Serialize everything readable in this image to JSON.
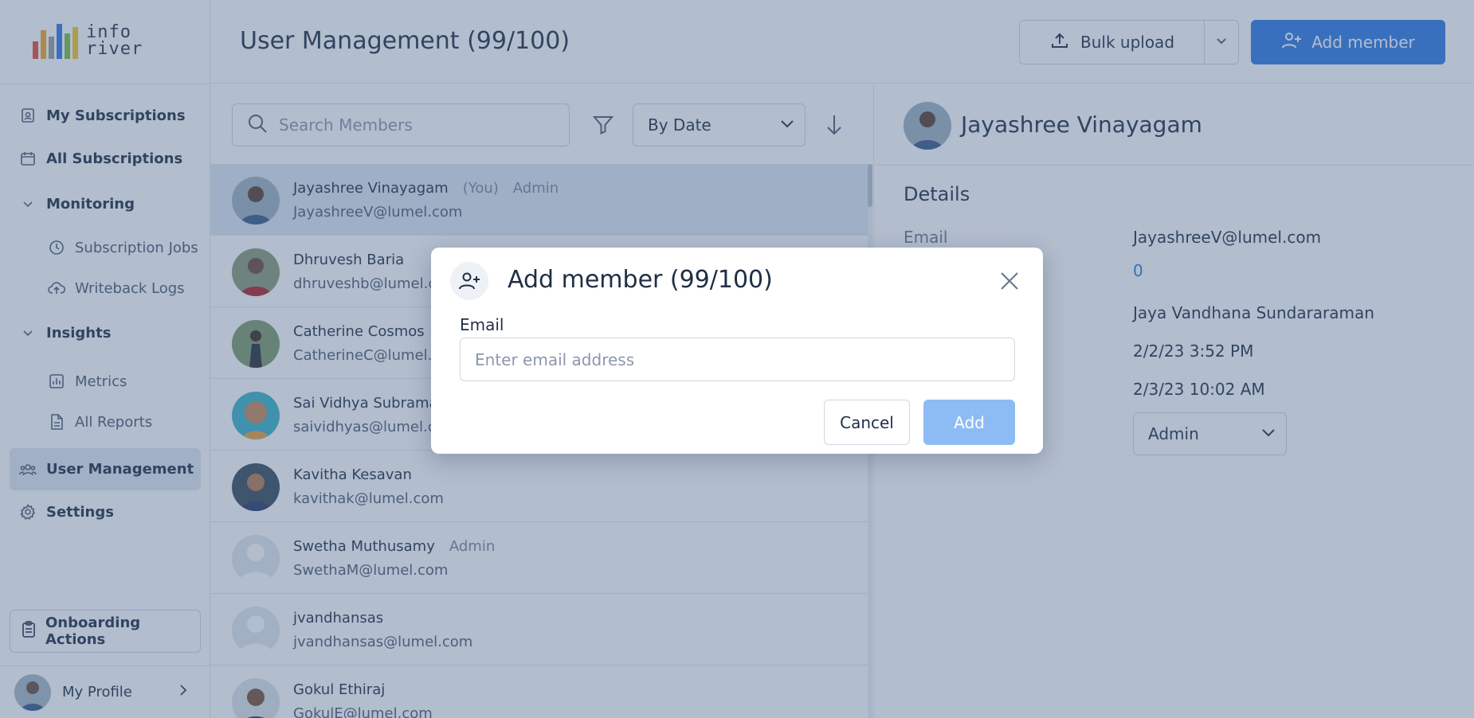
{
  "app": {
    "logo_text_line1": "info",
    "logo_text_line2": "river",
    "logo_bar_colors": [
      "#e94b3c",
      "#f5a623",
      "#9b9b9b",
      "#2f7be6",
      "#7ac043",
      "#f5c623"
    ]
  },
  "sidebar": {
    "items": [
      {
        "label": "My Subscriptions",
        "icon": "subscription-icon"
      },
      {
        "label": "All Subscriptions",
        "icon": "calendar-icon"
      },
      {
        "label": "Monitoring",
        "icon": "chevron-down-icon"
      },
      {
        "label": "Subscription Jobs",
        "icon": "clock-icon"
      },
      {
        "label": "Writeback Logs",
        "icon": "cloud-upload-icon"
      },
      {
        "label": "Insights",
        "icon": "chevron-down-icon"
      },
      {
        "label": "Metrics",
        "icon": "bar-chart-icon"
      },
      {
        "label": "All Reports",
        "icon": "document-icon"
      },
      {
        "label": "User Management",
        "icon": "users-icon"
      },
      {
        "label": "Settings",
        "icon": "gear-icon"
      }
    ],
    "onboarding_label": "Onboarding Actions",
    "profile_label": "My Profile"
  },
  "header": {
    "title": "User Management (99/100)",
    "bulk_upload_label": "Bulk upload",
    "add_member_label": "Add member"
  },
  "members": {
    "search_placeholder": "Search Members",
    "sort_value": "By Date",
    "rows": [
      {
        "name": "Jayashree Vinayagam",
        "you": "(You)",
        "role": "Admin",
        "email": "JayashreeV@lumel.com"
      },
      {
        "name": "Dhruvesh Baria",
        "you": "",
        "role": "",
        "email": "dhruveshb@lumel.com"
      },
      {
        "name": "Catherine Cosmos",
        "you": "",
        "role": "",
        "email": "CatherineC@lumel.com"
      },
      {
        "name": "Sai Vidhya Subramanian",
        "you": "",
        "role": "",
        "email": "saividhyas@lumel.com"
      },
      {
        "name": "Kavitha Kesavan",
        "you": "",
        "role": "",
        "email": "kavithak@lumel.com"
      },
      {
        "name": "Swetha Muthusamy",
        "you": "",
        "role": "Admin",
        "email": "SwethaM@lumel.com"
      },
      {
        "name": "jvandhansas",
        "you": "",
        "role": "",
        "email": "jvandhansas@lumel.com"
      },
      {
        "name": "Gokul Ethiraj",
        "you": "",
        "role": "",
        "email": "GokulE@lumel.com"
      }
    ]
  },
  "details": {
    "name": "Jayashree Vinayagam",
    "section_title": "Details",
    "email_label": "Email",
    "email_value": "JayashreeV@lumel.com",
    "count_value": "0",
    "added_by": "Jaya Vandhana Sundararaman",
    "date_1": "2/2/23 3:52 PM",
    "date_2": "2/3/23 10:02 AM",
    "role_value": "Admin"
  },
  "modal": {
    "title": "Add member (99/100)",
    "email_label": "Email",
    "email_placeholder": "Enter email address",
    "cancel_label": "Cancel",
    "add_label": "Add"
  }
}
